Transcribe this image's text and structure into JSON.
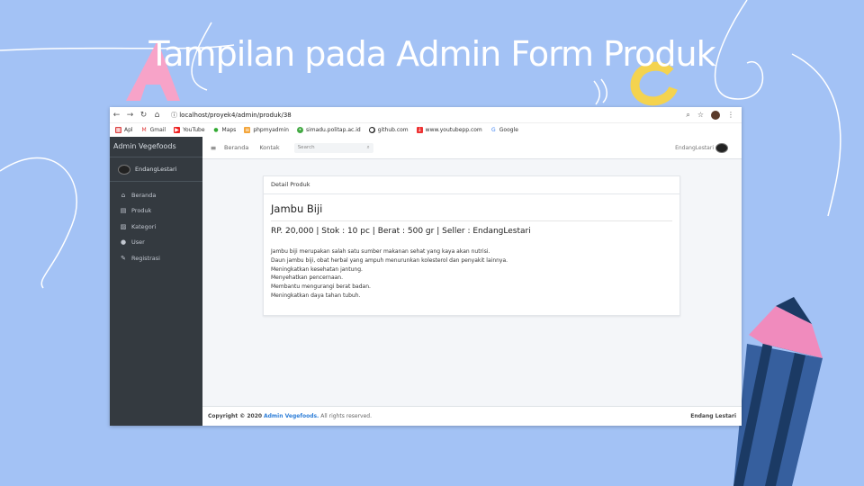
{
  "slide": {
    "title": "Tampilan pada Admin Form Produk"
  },
  "browser": {
    "url": "localhost/proyek4/admin/produk/38",
    "bookmarks": [
      "Apl",
      "Gmail",
      "YouTube",
      "Maps",
      "phpmyadmin",
      "simadu.politap.ac.id",
      "github.com",
      "www.youtubepp.com",
      "Google"
    ]
  },
  "sidebar": {
    "brand": "Admin Vegefoods",
    "user": "EndangLestari",
    "items": [
      {
        "label": "Beranda",
        "icon": "home-icon"
      },
      {
        "label": "Produk",
        "icon": "calendar-icon"
      },
      {
        "label": "Kategori",
        "icon": "image-icon"
      },
      {
        "label": "User",
        "icon": "user-icon"
      },
      {
        "label": "Registrasi",
        "icon": "edit-icon"
      }
    ]
  },
  "topbar": {
    "links": [
      "Beranda",
      "Kontak"
    ],
    "search_placeholder": "Search",
    "user": "EndangLestari"
  },
  "card": {
    "header": "Detail Produk",
    "product_name": "Jambu Biji",
    "meta": "RP. 20,000 | Stok : 10 pc | Berat : 500 gr | Seller : EndangLestari",
    "description": [
      "Jambu biji merupakan salah satu sumber makanan sehat yang kaya akan nutrisi.",
      "Daun jambu biji, obat herbal yang ampuh menurunkan kolesterol dan penyakit lainnya.",
      "Meningkatkan kesehatan jantung.",
      "Menyehatkan pencernaan.",
      "Membantu mengurangi berat badan.",
      "Meningkatkan daya tahan tubuh."
    ]
  },
  "footer": {
    "copyright": "Copyright © 2020",
    "brand": "Admin Vegefoods.",
    "rights": "All rights reserved.",
    "author": "Endang Lestari"
  },
  "colors": {
    "background": "#a3c2f5",
    "sidebar": "#343a40",
    "link": "#2f7fd8"
  }
}
